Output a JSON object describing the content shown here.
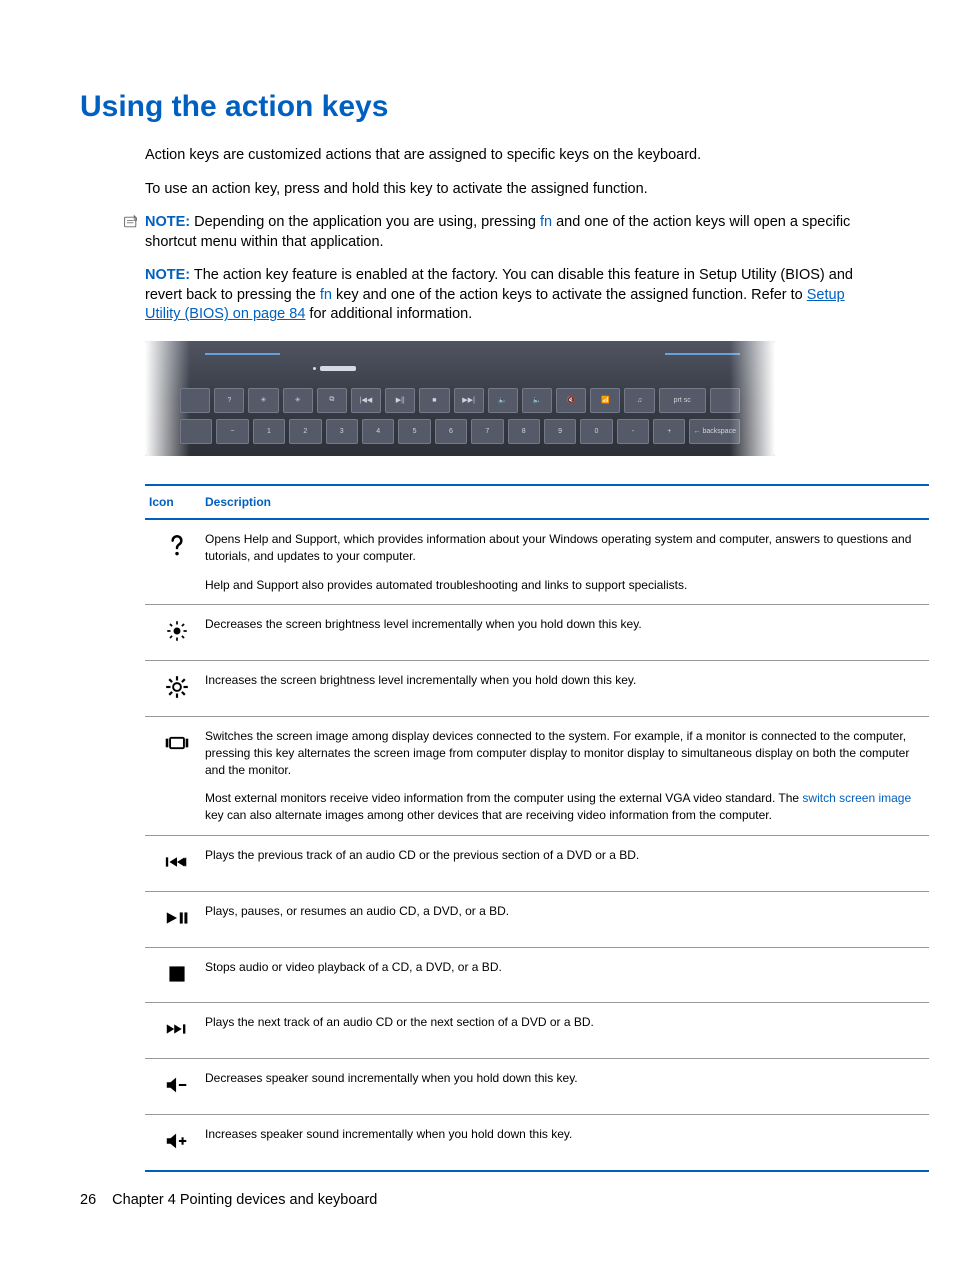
{
  "heading": "Using the action keys",
  "intro_p1": "Action keys are customized actions that are assigned to specific keys on the keyboard.",
  "intro_p2": "To use an action key, press and hold this key to activate the assigned function.",
  "note1": {
    "label": "NOTE:",
    "before_fn": "Depending on the application you are using, pressing ",
    "fn": "fn",
    "after_fn": " and one of the action keys will open a specific shortcut menu within that application."
  },
  "note2": {
    "label": "NOTE:",
    "before_fn": "The action key feature is enabled at the factory. You can disable this feature in Setup Utility (BIOS) and revert back to pressing the ",
    "fn": "fn",
    "after_fn": " key and one of the action keys to activate the assigned function. Refer to ",
    "link": "Setup Utility (BIOS) on page 84",
    "tail": " for additional information."
  },
  "table": {
    "head_icon": "Icon",
    "head_desc": "Description",
    "rows": [
      {
        "icon": "help",
        "paras": [
          "Opens Help and Support, which provides information about your Windows operating system and computer, answers to questions and tutorials, and updates to your computer.",
          "Help and Support also provides automated troubleshooting and links to support specialists."
        ]
      },
      {
        "icon": "brightness-down",
        "paras": [
          "Decreases the screen brightness level incrementally when you hold down this key."
        ]
      },
      {
        "icon": "brightness-up",
        "paras": [
          "Increases the screen brightness level incrementally when you hold down this key."
        ]
      },
      {
        "icon": "switch-screen",
        "para1_a": "Switches the screen image among display devices connected to the system. For example, if a monitor is connected to the computer, pressing this key alternates the screen image from computer display to monitor display to simultaneous display on both the computer and the monitor.",
        "para2_a": "Most external monitors receive video information from the computer using the external VGA video standard. The ",
        "para2_link": "switch screen image",
        "para2_b": " key can also alternate images among other devices that are receiving video information from the computer."
      },
      {
        "icon": "prev-track",
        "paras": [
          "Plays the previous track of an audio CD or the previous section of a DVD or a BD."
        ]
      },
      {
        "icon": "play-pause",
        "paras": [
          "Plays, pauses, or resumes an audio CD, a DVD, or a BD."
        ]
      },
      {
        "icon": "stop",
        "paras": [
          "Stops audio or video playback of a CD, a DVD, or a BD."
        ]
      },
      {
        "icon": "next-track",
        "paras": [
          "Plays the next track of an audio CD or the next section of a DVD or a BD."
        ]
      },
      {
        "icon": "volume-down",
        "paras": [
          "Decreases speaker sound incrementally when you hold down this key."
        ]
      },
      {
        "icon": "volume-up",
        "paras": [
          "Increases speaker sound incrementally when you hold down this key."
        ]
      }
    ]
  },
  "footer": {
    "page": "26",
    "chapter": "Chapter 4   Pointing devices and keyboard"
  }
}
